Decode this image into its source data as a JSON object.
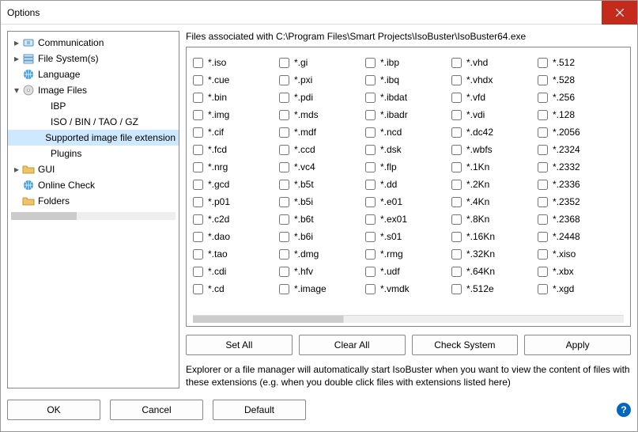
{
  "window": {
    "title": "Options"
  },
  "sidebar": {
    "items": [
      {
        "label": "Communication",
        "expandable": true,
        "expanded": false,
        "indent": 0,
        "icon": "comm"
      },
      {
        "label": "File System(s)",
        "expandable": true,
        "expanded": false,
        "indent": 0,
        "icon": "fs"
      },
      {
        "label": "Language",
        "expandable": false,
        "expanded": false,
        "indent": 0,
        "icon": "globe"
      },
      {
        "label": "Image Files",
        "expandable": true,
        "expanded": true,
        "indent": 0,
        "icon": "disc"
      },
      {
        "label": "IBP",
        "expandable": false,
        "expanded": false,
        "indent": 1,
        "icon": "none"
      },
      {
        "label": "ISO / BIN / TAO / GZ",
        "expandable": false,
        "expanded": false,
        "indent": 1,
        "icon": "none"
      },
      {
        "label": "Supported image file extension",
        "expandable": false,
        "expanded": false,
        "indent": 1,
        "icon": "none",
        "selected": true
      },
      {
        "label": "Plugins",
        "expandable": false,
        "expanded": false,
        "indent": 1,
        "icon": "none"
      },
      {
        "label": "GUI",
        "expandable": true,
        "expanded": false,
        "indent": 0,
        "icon": "folder"
      },
      {
        "label": "Online Check",
        "expandable": false,
        "expanded": false,
        "indent": 0,
        "icon": "globe"
      },
      {
        "label": "Folders",
        "expandable": false,
        "expanded": false,
        "indent": 0,
        "icon": "folder"
      }
    ]
  },
  "main": {
    "assoc_label": "Files associated with C:\\Program Files\\Smart Projects\\IsoBuster\\IsoBuster64.exe",
    "columns": [
      [
        "*.iso",
        "*.cue",
        "*.bin",
        "*.img",
        "*.cif",
        "*.fcd",
        "*.nrg",
        "*.gcd",
        "*.p01",
        "*.c2d",
        "*.dao",
        "*.tao",
        "*.cdi",
        "*.cd"
      ],
      [
        "*.gi",
        "*.pxi",
        "*.pdi",
        "*.mds",
        "*.mdf",
        "*.ccd",
        "*.vc4",
        "*.b5t",
        "*.b5i",
        "*.b6t",
        "*.b6i",
        "*.dmg",
        "*.hfv",
        "*.image"
      ],
      [
        "*.ibp",
        "*.ibq",
        "*.ibdat",
        "*.ibadr",
        "*.ncd",
        "*.dsk",
        "*.flp",
        "*.dd",
        "*.e01",
        "*.ex01",
        "*.s01",
        "*.rmg",
        "*.udf",
        "*.vmdk"
      ],
      [
        "*.vhd",
        "*.vhdx",
        "*.vfd",
        "*.vdi",
        "*.dc42",
        "*.wbfs",
        "*.1Kn",
        "*.2Kn",
        "*.4Kn",
        "*.8Kn",
        "*.16Kn",
        "*.32Kn",
        "*.64Kn",
        "*.512e"
      ],
      [
        "*.512",
        "*.528",
        "*.256",
        "*.128",
        "*.2056",
        "*.2324",
        "*.2332",
        "*.2336",
        "*.2352",
        "*.2368",
        "*.2448",
        "*.xiso",
        "*.xbx",
        "*.xgd"
      ]
    ],
    "buttons": {
      "set_all": "Set All",
      "clear_all": "Clear All",
      "check_system": "Check System",
      "apply": "Apply"
    },
    "description": "Explorer or a file manager will automatically start IsoBuster when you want to view the content of files with these extensions (e.g. when you double click files with extensions listed here)"
  },
  "footer": {
    "ok": "OK",
    "cancel": "Cancel",
    "default": "Default"
  }
}
